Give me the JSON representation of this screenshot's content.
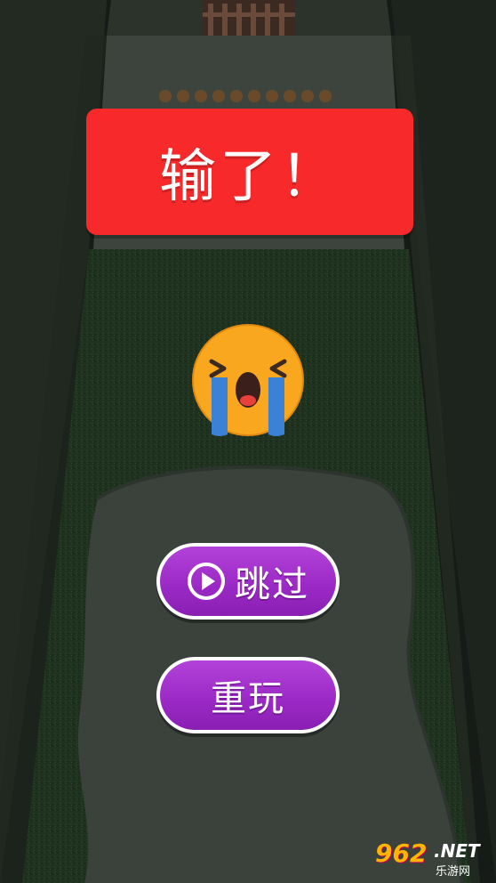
{
  "result_banner": {
    "text": "输了！",
    "color": "#f7292a"
  },
  "emoji": {
    "icon": "crying-face-icon"
  },
  "buttons": {
    "skip_label": "跳过",
    "skip_icon": "play-circle-icon",
    "replay_label": "重玩",
    "color": "#9c2ac6"
  },
  "watermark": {
    "number": "962",
    "domain": ".NET",
    "subtitle": "乐游网"
  }
}
